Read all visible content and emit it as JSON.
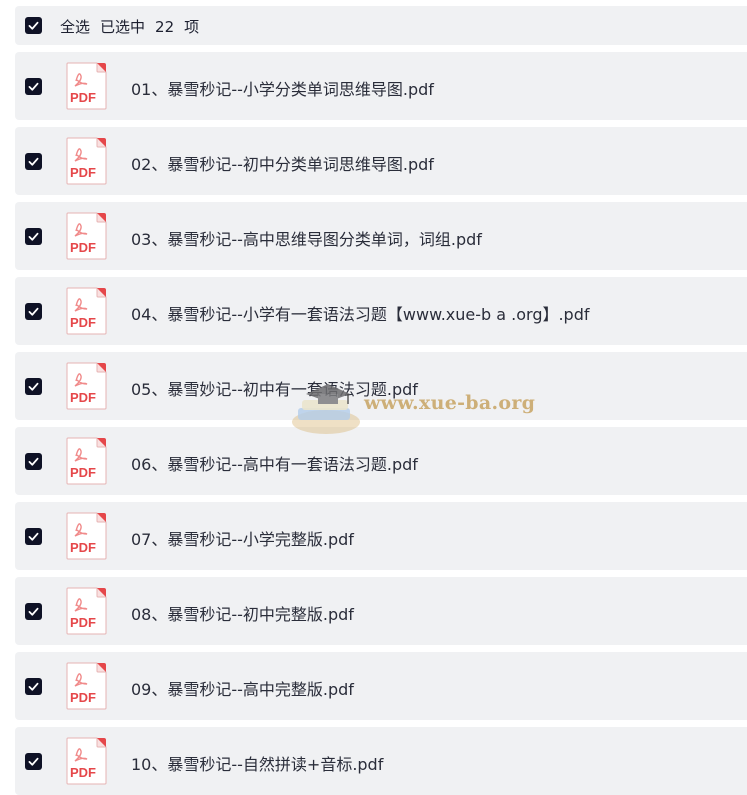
{
  "header": {
    "select_all_label": "全选",
    "selected_prefix": "已选中",
    "selected_count": "22",
    "selected_suffix": "项"
  },
  "file_icon_label": "PDF",
  "files": [
    {
      "name": "01、暴雪秒记--小学分类单词思维导图.pdf",
      "checked": true
    },
    {
      "name": "02、暴雪秒记--初中分类单词思维导图.pdf",
      "checked": true
    },
    {
      "name": "03、暴雪秒记--高中思维导图分类单词，词组.pdf",
      "checked": true
    },
    {
      "name": "04、暴雪秒记--小学有一套语法习题【www.xue-b a .org】.pdf",
      "checked": true
    },
    {
      "name": "05、暴雪妙记--初中有一套语法习题.pdf",
      "checked": true
    },
    {
      "name": "06、暴雪秒记--高中有一套语法习题.pdf",
      "checked": true
    },
    {
      "name": "07、暴雪秒记--小学完整版.pdf",
      "checked": true
    },
    {
      "name": "08、暴雪秒记--初中完整版.pdf",
      "checked": true
    },
    {
      "name": "09、暴雪秒记--高中完整版.pdf",
      "checked": true
    },
    {
      "name": "10、暴雪秒记--自然拼读+音标.pdf",
      "checked": true
    }
  ],
  "watermark": {
    "text": "www.xue-ba.org"
  },
  "colors": {
    "row_bg": "#f0f1f3",
    "checkbox": "#0f1226",
    "pdf_red": "#e5474a"
  }
}
